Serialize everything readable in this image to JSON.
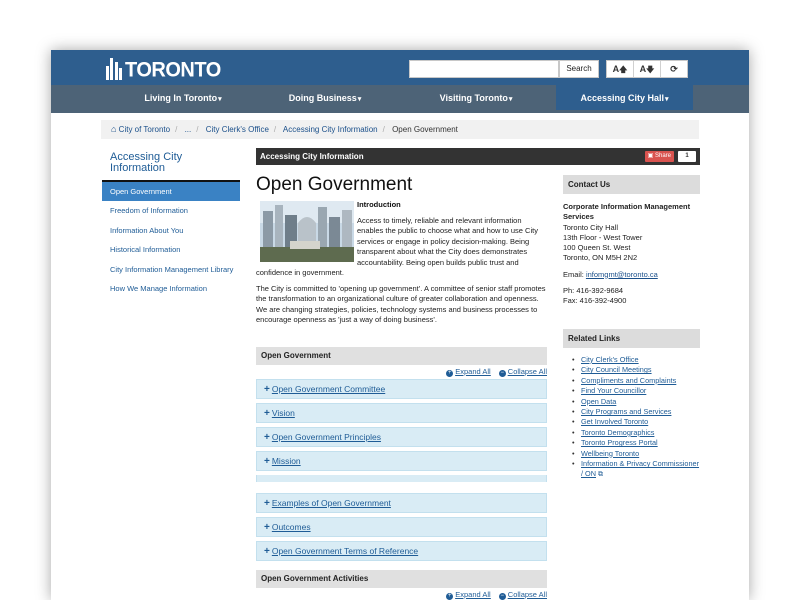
{
  "header": {
    "logo_text": "TORONTO",
    "search_placeholder": "",
    "search_button": "Search",
    "tools": [
      "A🡅",
      "A🡇",
      "⟳"
    ]
  },
  "nav": [
    {
      "label": "Living In Toronto",
      "active": false
    },
    {
      "label": "Doing Business",
      "active": false
    },
    {
      "label": "Visiting Toronto",
      "active": false
    },
    {
      "label": "Accessing City Hall",
      "active": true
    }
  ],
  "breadcrumb": [
    "City of Toronto",
    "...",
    "City Clerk's Office",
    "Accessing City Information",
    "Open Government"
  ],
  "leftnav": {
    "title": "Accessing City Information",
    "items": [
      "Open Government",
      "Freedom of Information",
      "Information About You",
      "Historical Information",
      "City Information Management Library",
      "How We Manage Information"
    ]
  },
  "content": {
    "bar_title": "Accessing City Information",
    "share_label": "Share",
    "share_count": "1",
    "page_title": "Open Government",
    "intro_heading": "Introduction",
    "intro_text": "Access to timely, reliable and relevant information enables the public to choose what and how to use City services or engage in policy decision-making.  Being transparent about what the City does demonstrates accountability.  Being open builds public trust and",
    "intro_tail": "confidence in government.",
    "para2": "The City is committed to 'opening up government'.  A committee of senior staff promotes the transformation to an organizational culture of greater collaboration and openness.  We are changing strategies, policies, technology systems and business processes to encourage openness as 'just a way of doing business'."
  },
  "accordion1": {
    "title": "Open Government",
    "expand_all": "Expand All",
    "collapse_all": "Collapse All",
    "items": [
      "Open Government Committee",
      "Vision",
      "Open Government Principles",
      "Mission",
      "Examples of Open Government",
      "Outcomes",
      "Open Government Terms of Reference"
    ]
  },
  "accordion2": {
    "title": "Open Government Activities",
    "expand_all": "Expand All",
    "collapse_all": "Collapse All"
  },
  "contact": {
    "title": "Contact Us",
    "org": "Corporate Information Management Services",
    "lines": [
      "Toronto City Hall",
      "13th Floor - West Tower",
      "100 Queen St. West",
      "Toronto, ON M5H 2N2"
    ],
    "email_label": "Email:",
    "email": "infomgmt@toronto.ca",
    "phone": "Ph: 416-392-9684",
    "fax": "Fax: 416-392-4900"
  },
  "related": {
    "title": "Related Links",
    "items": [
      "City Clerk's Office",
      "City Council Meetings",
      "Compliments and Complaints",
      "Find Your Councillor",
      "Open Data",
      "City Programs and Services",
      "Get Involved Toronto",
      "Toronto Demographics",
      "Toronto Progress Portal",
      "Wellbeing Toronto",
      "Information & Privacy Commissioner / ON"
    ]
  },
  "colors": {
    "header_blue": "#2e5e8e",
    "nav_gray": "#4d6377",
    "link_blue": "#1f5c96",
    "active_blue": "#3a82c4",
    "accordion_bg": "#d9ecf5"
  }
}
